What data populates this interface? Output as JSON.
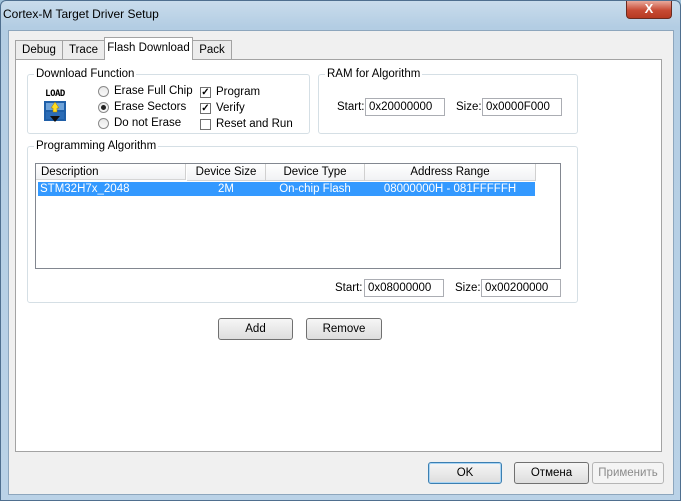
{
  "window": {
    "title": "Cortex-M Target Driver Setup",
    "close_symbol": "X"
  },
  "tabs": [
    {
      "label": "Debug"
    },
    {
      "label": "Trace"
    },
    {
      "label": "Flash Download"
    },
    {
      "label": "Pack"
    }
  ],
  "download_function": {
    "group_label": "Download Function",
    "icon_text": "LOAD",
    "options": [
      {
        "label": "Erase Full Chip",
        "selected": false
      },
      {
        "label": "Erase Sectors",
        "selected": true
      },
      {
        "label": "Do not Erase",
        "selected": false
      }
    ],
    "checks": [
      {
        "label": "Program",
        "checked": true,
        "mark": "✓"
      },
      {
        "label": "Verify",
        "checked": true,
        "mark": "✓"
      },
      {
        "label": "Reset and Run",
        "checked": false,
        "mark": ""
      }
    ]
  },
  "ram": {
    "group_label": "RAM for Algorithm",
    "start_label": "Start:",
    "start_value": "0x20000000",
    "size_label": "Size:",
    "size_value": "0x0000F000"
  },
  "programming_algorithm": {
    "group_label": "Programming Algorithm",
    "columns": [
      "Description",
      "Device Size",
      "Device Type",
      "Address Range"
    ],
    "rows": [
      {
        "description": "STM32H7x_2048",
        "device_size": "2M",
        "device_type": "On-chip Flash",
        "address_range": "08000000H - 081FFFFFH"
      }
    ],
    "start_label": "Start:",
    "start_value": "0x08000000",
    "size_label": "Size:",
    "size_value": "0x00200000",
    "add_label": "Add",
    "remove_label": "Remove"
  },
  "footer": {
    "ok_label": "OK",
    "cancel_label": "Отмена",
    "apply_label": "Применить"
  }
}
